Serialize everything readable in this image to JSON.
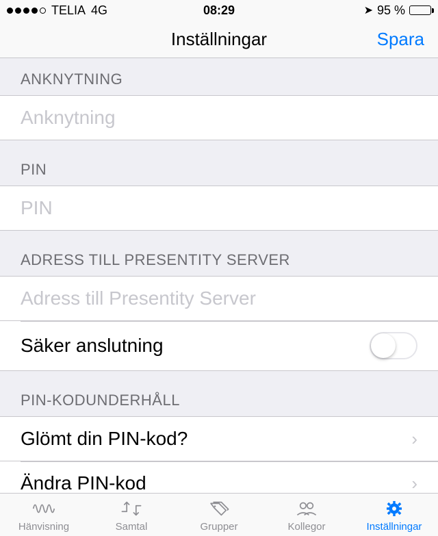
{
  "status": {
    "carrier": "TELIA",
    "network": "4G",
    "time": "08:29",
    "battery_pct": "95 %"
  },
  "nav": {
    "title": "Inställningar",
    "save": "Spara"
  },
  "sections": {
    "anknytning": {
      "header": "ANKNYTNING",
      "placeholder": "Anknytning"
    },
    "pin": {
      "header": "PIN",
      "placeholder": "PIN"
    },
    "server": {
      "header": "ADRESS TILL PRESENTITY SERVER",
      "placeholder": "Adress till Presentity Server",
      "secure_label": "Säker anslutning"
    },
    "pin_maint": {
      "header": "PIN-KODUNDERHÅLL",
      "forgot": "Glömt din PIN-kod?",
      "change": "Ändra PIN-kod"
    }
  },
  "tabs": {
    "hanvisning": "Hänvisning",
    "samtal": "Samtal",
    "grupper": "Grupper",
    "kollegor": "Kollegor",
    "installningar": "Inställningar"
  }
}
